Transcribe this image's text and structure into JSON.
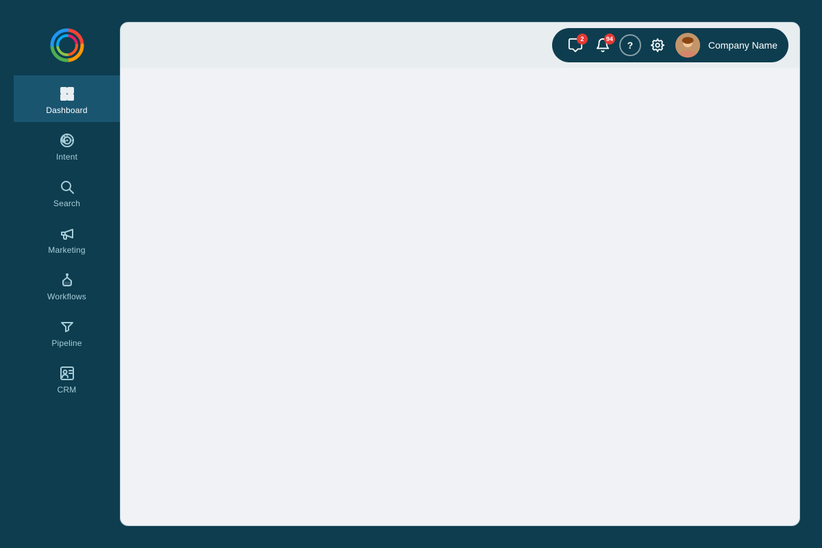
{
  "sidebar": {
    "logo_label": "App Logo",
    "items": [
      {
        "id": "dashboard",
        "label": "Dashboard",
        "active": true,
        "icon": "grid"
      },
      {
        "id": "intent",
        "label": "Intent",
        "active": false,
        "icon": "target"
      },
      {
        "id": "search",
        "label": "Search",
        "active": false,
        "icon": "search"
      },
      {
        "id": "marketing",
        "label": "Marketing",
        "active": false,
        "icon": "megaphone"
      },
      {
        "id": "workflows",
        "label": "Workflows",
        "active": false,
        "icon": "workflows"
      },
      {
        "id": "pipeline",
        "label": "Pipeline",
        "active": false,
        "icon": "filter"
      },
      {
        "id": "crm",
        "label": "CRM",
        "active": false,
        "icon": "crm"
      }
    ]
  },
  "header": {
    "messages_badge": "2",
    "notifications_badge": "94",
    "help_label": "?",
    "company_name": "Company Name"
  }
}
